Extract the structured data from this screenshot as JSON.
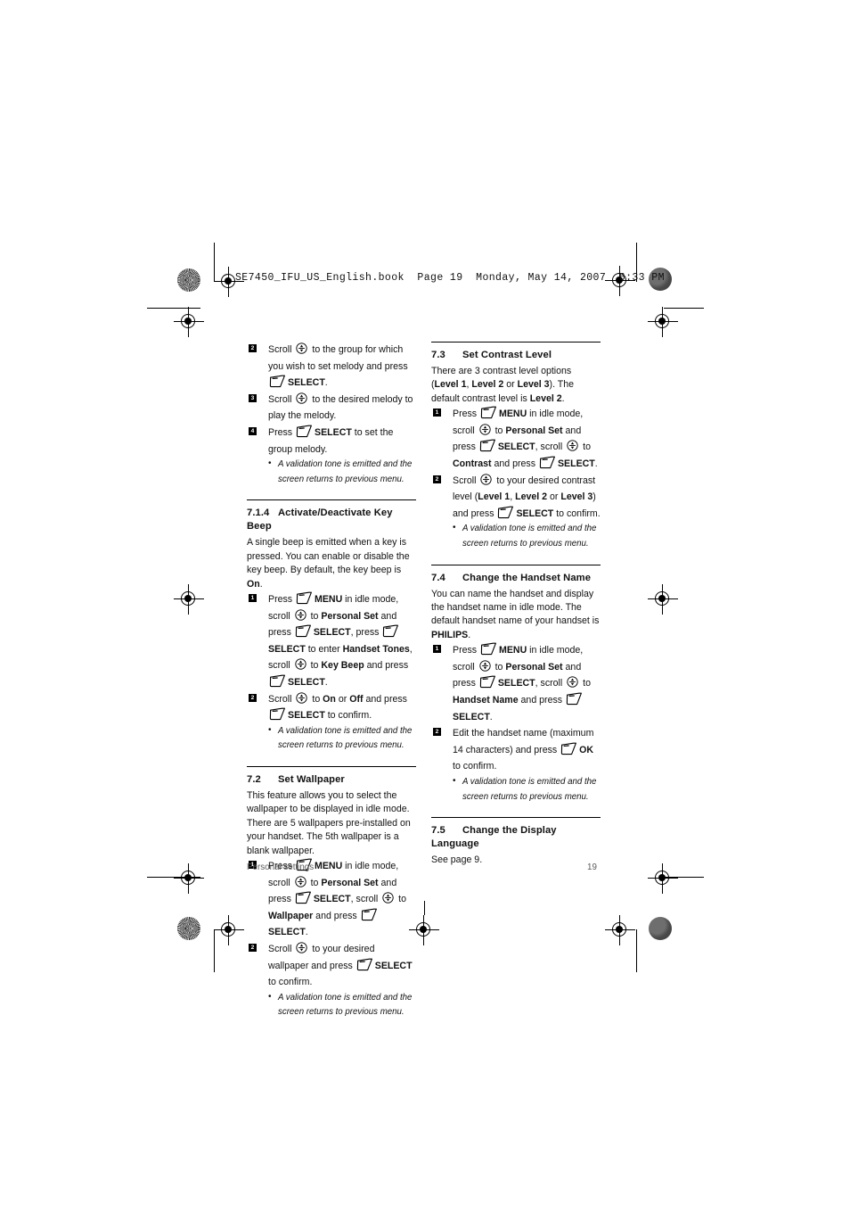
{
  "prepress": {
    "file_header": "SE7450_IFU_US_English.book  Page 19  Monday, May 14, 2007  6:33 PM"
  },
  "footer": {
    "left_label": "Personal settings",
    "page_number": "19"
  },
  "icons": {
    "softkey": "softkey-icon",
    "scroll": "scroll-updown-icon"
  },
  "left_column": {
    "continued_steps": [
      {
        "number": "2",
        "parts": [
          {
            "t": "text",
            "v": "Scroll "
          },
          {
            "t": "icon",
            "v": "scroll"
          },
          {
            "t": "text",
            "v": " to the group for which you wish to set melody and press "
          },
          {
            "t": "icon",
            "v": "softkey"
          },
          {
            "t": "bold",
            "v": "SELECT"
          },
          {
            "t": "text",
            "v": "."
          }
        ]
      },
      {
        "number": "3",
        "parts": [
          {
            "t": "text",
            "v": "Scroll "
          },
          {
            "t": "icon",
            "v": "scroll"
          },
          {
            "t": "text",
            "v": " to the desired melody to play the melody."
          }
        ]
      },
      {
        "number": "4",
        "parts": [
          {
            "t": "text",
            "v": "Press "
          },
          {
            "t": "icon",
            "v": "softkey"
          },
          {
            "t": "bold",
            "v": "SELECT"
          },
          {
            "t": "text",
            "v": " to set the group melody."
          }
        ]
      }
    ],
    "continued_note": "A validation tone is emitted and the screen returns to previous menu.",
    "sections": [
      {
        "number": "7.1.4",
        "title": "Activate/Deactivate Key Beep",
        "intro": [
          {
            "t": "text",
            "v": "A single beep is emitted when a key is pressed. You can enable or disable the key beep. By default, the key beep is "
          },
          {
            "t": "bold",
            "v": "On"
          },
          {
            "t": "text",
            "v": "."
          }
        ],
        "steps": [
          {
            "number": "1",
            "parts": [
              {
                "t": "text",
                "v": "Press "
              },
              {
                "t": "icon",
                "v": "softkey"
              },
              {
                "t": "bold",
                "v": "MENU"
              },
              {
                "t": "text",
                "v": " in idle mode, scroll "
              },
              {
                "t": "icon",
                "v": "scroll"
              },
              {
                "t": "text",
                "v": " to "
              },
              {
                "t": "bold",
                "v": "Personal Set"
              },
              {
                "t": "text",
                "v": " and press "
              },
              {
                "t": "icon",
                "v": "softkey"
              },
              {
                "t": "bold",
                "v": "SELECT"
              },
              {
                "t": "text",
                "v": ", press "
              },
              {
                "t": "icon",
                "v": "softkey"
              },
              {
                "t": "bold",
                "v": "SELECT"
              },
              {
                "t": "text",
                "v": " to enter "
              },
              {
                "t": "bold",
                "v": "Handset Tones"
              },
              {
                "t": "text",
                "v": ", scroll "
              },
              {
                "t": "icon",
                "v": "scroll"
              },
              {
                "t": "text",
                "v": " to "
              },
              {
                "t": "bold",
                "v": "Key Beep"
              },
              {
                "t": "text",
                "v": " and press "
              },
              {
                "t": "icon",
                "v": "softkey"
              },
              {
                "t": "bold",
                "v": "SELECT"
              },
              {
                "t": "text",
                "v": "."
              }
            ]
          },
          {
            "number": "2",
            "parts": [
              {
                "t": "text",
                "v": "Scroll "
              },
              {
                "t": "icon",
                "v": "scroll"
              },
              {
                "t": "text",
                "v": " to "
              },
              {
                "t": "bold",
                "v": "On"
              },
              {
                "t": "text",
                "v": " or "
              },
              {
                "t": "bold",
                "v": "Off"
              },
              {
                "t": "text",
                "v": " and press "
              },
              {
                "t": "icon",
                "v": "softkey"
              },
              {
                "t": "bold",
                "v": "SELECT"
              },
              {
                "t": "text",
                "v": " to confirm."
              }
            ]
          }
        ],
        "note": "A validation tone is emitted and the screen returns to previous menu."
      },
      {
        "number": "7.2",
        "title": "Set Wallpaper",
        "intro": [
          {
            "t": "text",
            "v": "This feature allows you to select the wallpaper to be displayed in idle mode. There are 5 wallpapers pre-installed on your handset. The 5th wallpaper is a blank wallpaper."
          }
        ],
        "steps": [
          {
            "number": "1",
            "parts": [
              {
                "t": "text",
                "v": "Press "
              },
              {
                "t": "icon",
                "v": "softkey"
              },
              {
                "t": "bold",
                "v": "MENU"
              },
              {
                "t": "text",
                "v": " in idle mode, scroll "
              },
              {
                "t": "icon",
                "v": "scroll"
              },
              {
                "t": "text",
                "v": " to "
              },
              {
                "t": "bold",
                "v": "Personal Set"
              },
              {
                "t": "text",
                "v": " and press "
              },
              {
                "t": "icon",
                "v": "softkey"
              },
              {
                "t": "bold",
                "v": "SELECT"
              },
              {
                "t": "text",
                "v": ", scroll "
              },
              {
                "t": "icon",
                "v": "scroll"
              },
              {
                "t": "text",
                "v": " to "
              },
              {
                "t": "bold",
                "v": "Wallpaper"
              },
              {
                "t": "text",
                "v": " and press "
              },
              {
                "t": "icon",
                "v": "softkey"
              },
              {
                "t": "bold",
                "v": "SELECT"
              },
              {
                "t": "text",
                "v": "."
              }
            ]
          },
          {
            "number": "2",
            "parts": [
              {
                "t": "text",
                "v": "Scroll "
              },
              {
                "t": "icon",
                "v": "scroll"
              },
              {
                "t": "text",
                "v": " to your desired wallpaper and press "
              },
              {
                "t": "icon",
                "v": "softkey"
              },
              {
                "t": "bold",
                "v": "SELECT"
              },
              {
                "t": "text",
                "v": " to confirm."
              }
            ]
          }
        ],
        "note": "A validation tone is emitted and the screen returns to previous menu."
      }
    ]
  },
  "right_column": {
    "sections": [
      {
        "number": "7.3",
        "title": "Set Contrast Level",
        "intro": [
          {
            "t": "text",
            "v": "There are 3 contrast level options ("
          },
          {
            "t": "bold",
            "v": "Level 1"
          },
          {
            "t": "text",
            "v": ", "
          },
          {
            "t": "bold",
            "v": "Level 2"
          },
          {
            "t": "text",
            "v": " or "
          },
          {
            "t": "bold",
            "v": "Level 3"
          },
          {
            "t": "text",
            "v": "). The default contrast level is "
          },
          {
            "t": "bold",
            "v": "Level 2"
          },
          {
            "t": "text",
            "v": "."
          }
        ],
        "steps": [
          {
            "number": "1",
            "parts": [
              {
                "t": "text",
                "v": "Press "
              },
              {
                "t": "icon",
                "v": "softkey"
              },
              {
                "t": "bold",
                "v": "MENU"
              },
              {
                "t": "text",
                "v": " in idle mode, scroll "
              },
              {
                "t": "icon",
                "v": "scroll"
              },
              {
                "t": "text",
                "v": " to "
              },
              {
                "t": "bold",
                "v": "Personal Set"
              },
              {
                "t": "text",
                "v": " and press "
              },
              {
                "t": "icon",
                "v": "softkey"
              },
              {
                "t": "bold",
                "v": "SELECT"
              },
              {
                "t": "text",
                "v": ", scroll "
              },
              {
                "t": "icon",
                "v": "scroll"
              },
              {
                "t": "text",
                "v": " to "
              },
              {
                "t": "bold",
                "v": "Contrast"
              },
              {
                "t": "text",
                "v": " and press "
              },
              {
                "t": "icon",
                "v": "softkey"
              },
              {
                "t": "bold",
                "v": "SELECT"
              },
              {
                "t": "text",
                "v": "."
              }
            ]
          },
          {
            "number": "2",
            "parts": [
              {
                "t": "text",
                "v": "Scroll "
              },
              {
                "t": "icon",
                "v": "scroll"
              },
              {
                "t": "text",
                "v": " to your desired contrast level ("
              },
              {
                "t": "bold",
                "v": "Level 1"
              },
              {
                "t": "text",
                "v": ", "
              },
              {
                "t": "bold",
                "v": "Level 2"
              },
              {
                "t": "text",
                "v": " or "
              },
              {
                "t": "bold",
                "v": "Level 3"
              },
              {
                "t": "text",
                "v": ") and press "
              },
              {
                "t": "icon",
                "v": "softkey"
              },
              {
                "t": "bold",
                "v": "SELECT"
              },
              {
                "t": "text",
                "v": " to confirm."
              }
            ]
          }
        ],
        "note": "A validation tone is emitted and the screen returns to previous menu."
      },
      {
        "number": "7.4",
        "title": "Change the Handset Name",
        "intro": [
          {
            "t": "text",
            "v": "You can name the handset and display the handset name in idle mode. The default handset name of your handset is "
          },
          {
            "t": "bold",
            "v": "PHILIPS"
          },
          {
            "t": "text",
            "v": "."
          }
        ],
        "steps": [
          {
            "number": "1",
            "parts": [
              {
                "t": "text",
                "v": "Press "
              },
              {
                "t": "icon",
                "v": "softkey"
              },
              {
                "t": "bold",
                "v": "MENU"
              },
              {
                "t": "text",
                "v": " in idle mode, scroll "
              },
              {
                "t": "icon",
                "v": "scroll"
              },
              {
                "t": "text",
                "v": " to "
              },
              {
                "t": "bold",
                "v": "Personal Set"
              },
              {
                "t": "text",
                "v": " and press "
              },
              {
                "t": "icon",
                "v": "softkey"
              },
              {
                "t": "bold",
                "v": "SELECT"
              },
              {
                "t": "text",
                "v": ", scroll "
              },
              {
                "t": "icon",
                "v": "scroll"
              },
              {
                "t": "text",
                "v": " to "
              },
              {
                "t": "bold",
                "v": "Handset Name"
              },
              {
                "t": "text",
                "v": " and press "
              },
              {
                "t": "icon",
                "v": "softkey"
              },
              {
                "t": "bold",
                "v": "SELECT"
              },
              {
                "t": "text",
                "v": "."
              }
            ]
          },
          {
            "number": "2",
            "parts": [
              {
                "t": "text",
                "v": "Edit the handset name (maximum 14 characters) and press "
              },
              {
                "t": "icon",
                "v": "softkey"
              },
              {
                "t": "bold",
                "v": "OK"
              },
              {
                "t": "text",
                "v": " to confirm."
              }
            ]
          }
        ],
        "note": "A validation tone is emitted and the screen returns to previous menu."
      },
      {
        "number": "7.5",
        "title": "Change the Display Language",
        "intro": [
          {
            "t": "text",
            "v": "See page 9."
          }
        ],
        "steps": [],
        "note": null
      }
    ]
  }
}
